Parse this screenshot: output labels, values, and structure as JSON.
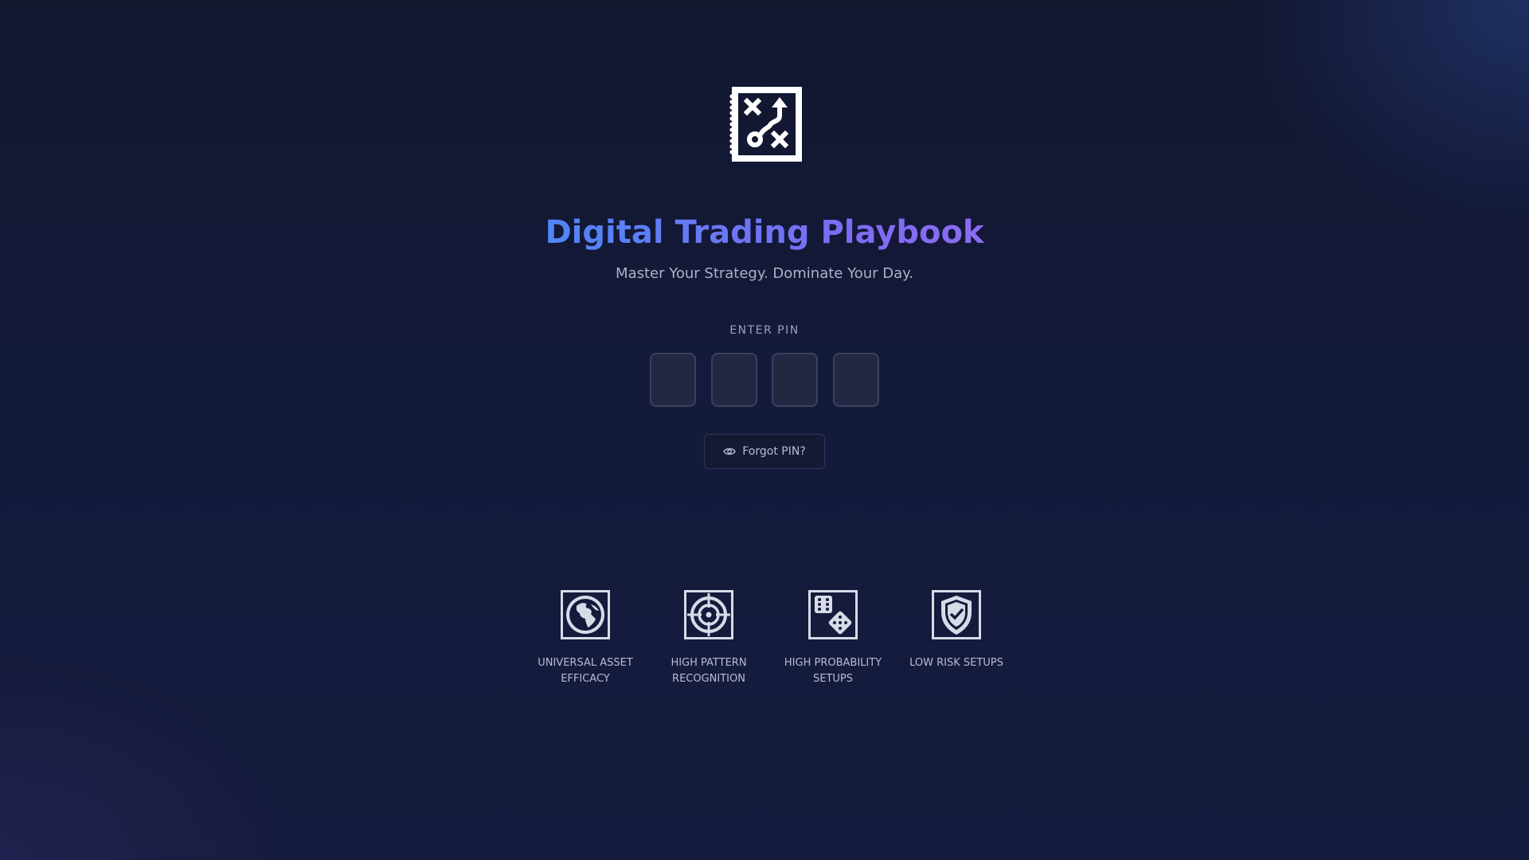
{
  "app": {
    "title": "Digital Trading Playbook",
    "subtitle": "Master Your Strategy. Dominate Your Day.",
    "logo_icon": "playbook-strategy-icon"
  },
  "pin": {
    "label": "ENTER PIN",
    "digits": [
      "",
      "",
      "",
      ""
    ],
    "forgot_label": "Forgot PIN?",
    "forgot_icon": "eye-icon"
  },
  "features": [
    {
      "label": "UNIVERSAL ASSET\nEFFICACY",
      "icon": "globe-icon"
    },
    {
      "label": "HIGH PATTERN\nRECOGNITION",
      "icon": "crosshair-icon"
    },
    {
      "label": "HIGH PROBABILITY\nSETUPS",
      "icon": "dice-icon"
    },
    {
      "label": "LOW RISK SETUPS",
      "icon": "shield-check-icon"
    }
  ],
  "colors": {
    "title_gradient_start": "#4f86f7",
    "title_gradient_end": "#8b6cf0",
    "background": "#141a3a"
  }
}
